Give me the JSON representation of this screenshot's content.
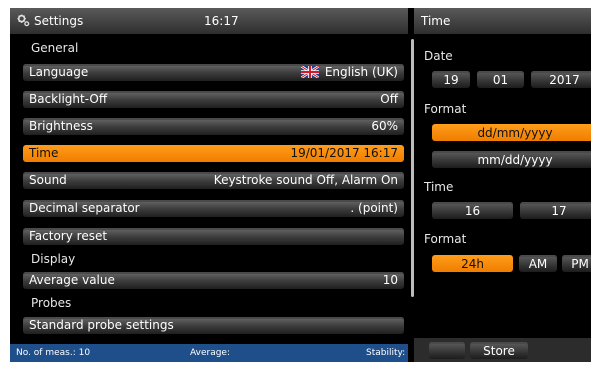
{
  "header": {
    "title": "Settings",
    "time": "16:17",
    "right_title": "Time"
  },
  "list": {
    "general_heading": "General",
    "display_heading": "Display",
    "probes_heading": "Probes",
    "items": [
      {
        "label": "Language",
        "value": "English (UK)"
      },
      {
        "label": "Backlight-Off",
        "value": "Off"
      },
      {
        "label": "Brightness",
        "value": "60%"
      },
      {
        "label": "Time",
        "value": "19/01/2017 16:17"
      },
      {
        "label": "Sound",
        "value": "Keystroke sound Off, Alarm On"
      },
      {
        "label": "Decimal separator",
        "value": ". (point)"
      },
      {
        "label": "Factory reset",
        "value": ""
      },
      {
        "label": "Average value",
        "value": "10"
      },
      {
        "label": "Standard probe settings",
        "value": ""
      }
    ]
  },
  "time_panel": {
    "date_label": "Date",
    "day": "19",
    "month": "01",
    "year": "2017",
    "date_format_label": "Format",
    "date_formats": [
      "dd/mm/yyyy",
      "mm/dd/yyyy"
    ],
    "time_label": "Time",
    "hour": "16",
    "minute": "17",
    "time_format_label": "Format",
    "time_formats": [
      "24h",
      "AM",
      "PM"
    ],
    "store_label": "Store"
  },
  "status_bar": {
    "meas": "No. of meas.: 10",
    "average": "Average:",
    "stability": "Stability:"
  },
  "colors": {
    "accent": "#f58a06",
    "status_bar": "#1f4f8a",
    "background": "#000000"
  }
}
